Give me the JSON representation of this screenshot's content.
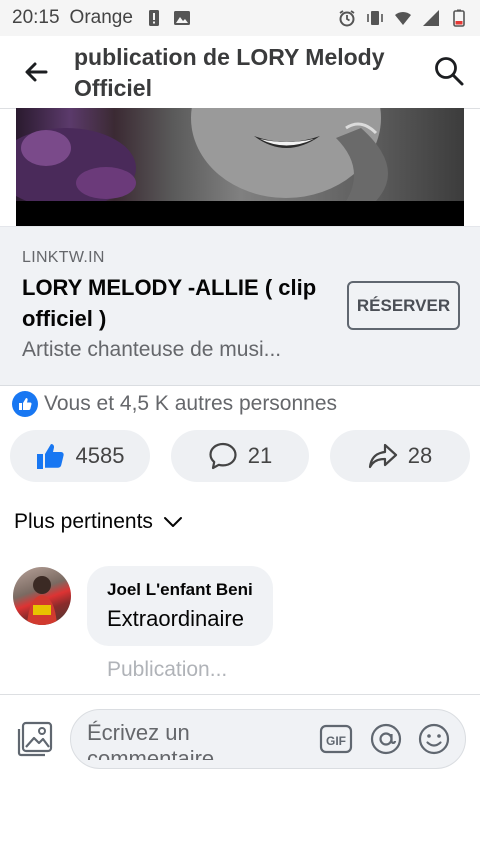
{
  "status_bar": {
    "time": "20:15",
    "carrier": "Orange"
  },
  "header": {
    "title": "publication de LORY Melody Officiel"
  },
  "link_preview": {
    "domain": "LINKTW.IN",
    "title": "LORY MELODY -ALLIE ( clip officiel )",
    "description": "Artiste chanteuse de musi...",
    "button_label": "RÉSERVER"
  },
  "reactions": {
    "summary": "Vous et 4,5 K autres personnes",
    "likes": "4585",
    "comments": "21",
    "shares": "28"
  },
  "sort": {
    "label": "Plus pertinents"
  },
  "comment": {
    "author": "Joel L'enfant Beni",
    "text": "Extraordinaire"
  },
  "publication_hint": "Publication...",
  "composer": {
    "placeholder": "Écrivez un commentaire"
  },
  "colors": {
    "accent_blue": "#1877f2",
    "pill_bg": "#eef0f3",
    "card_bg": "#f0f2f5"
  }
}
